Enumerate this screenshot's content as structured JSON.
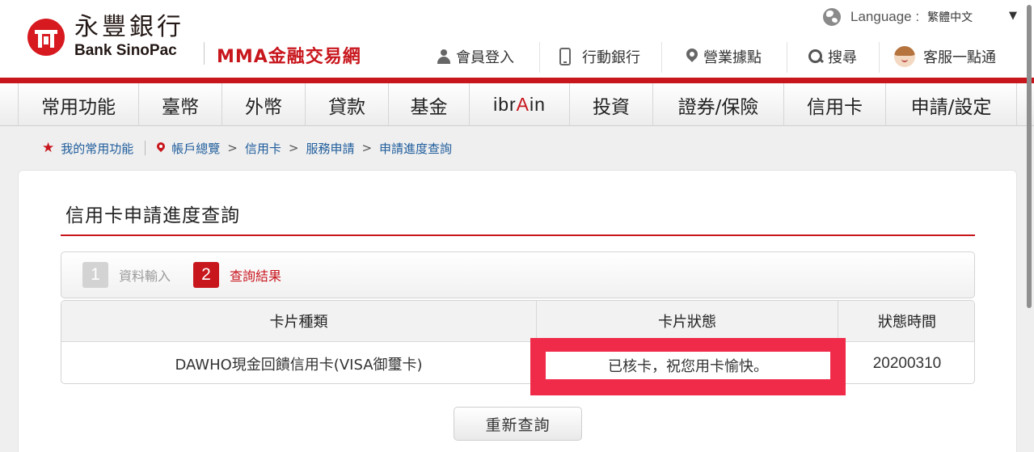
{
  "header": {
    "logo_cn": "永豐銀行",
    "logo_en": "Bank SinoPac",
    "site_name": "MMA金融交易網",
    "language_label": "Language :",
    "language_value": "繁體中文",
    "language_caret": "▼",
    "utility": {
      "login": "會員登入",
      "mobile": "行動銀行",
      "branches": "營業據點",
      "search": "搜尋",
      "service": "客服一點通"
    }
  },
  "nav": {
    "items": [
      "常用功能",
      "臺幣",
      "外幣",
      "貸款",
      "基金",
      "ibrAin",
      "投資",
      "證券/保險",
      "信用卡",
      "申請/設定"
    ]
  },
  "breadcrumb": {
    "favorite": "我的常用功能",
    "star": "★",
    "arrow": ">",
    "path": [
      "帳戶總覽",
      "信用卡",
      "服務申請",
      "申請進度查詢"
    ]
  },
  "page": {
    "title": "信用卡申請進度查詢",
    "steps": [
      {
        "num": "1",
        "label": "資料輸入",
        "active": false
      },
      {
        "num": "2",
        "label": "查詢結果",
        "active": true
      }
    ],
    "table": {
      "headers": [
        "卡片種類",
        "卡片狀態",
        "狀態時間"
      ],
      "rows": [
        [
          "DAWHO現金回饋信用卡(VISA御璽卡)",
          "已核卡，祝您用卡愉快。",
          "20200310"
        ]
      ]
    },
    "retry_button": "重新查詢"
  },
  "colors": {
    "brand_red": "#c8161d",
    "highlight": "#f02b4a",
    "link_blue": "#1f5d9c"
  }
}
